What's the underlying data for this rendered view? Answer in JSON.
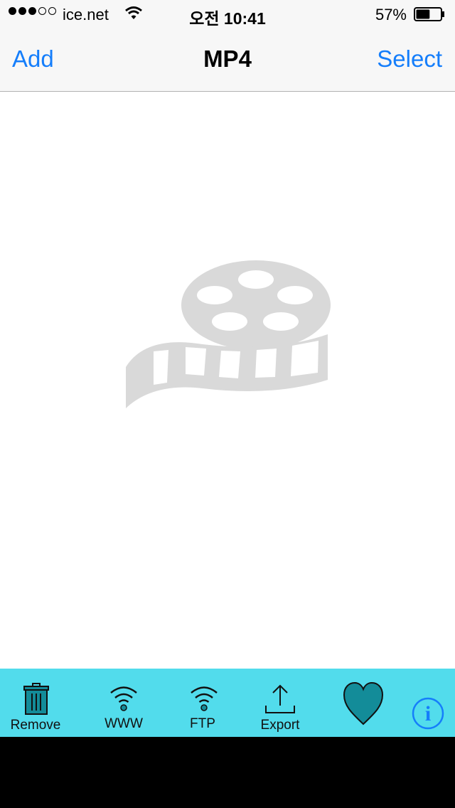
{
  "status_bar": {
    "signal_bars_filled": 3,
    "signal_bars_total": 5,
    "carrier": "ice.net",
    "time": "오전 10:41",
    "battery_percent": "57%",
    "battery_level": 0.57
  },
  "nav": {
    "left_label": "Add",
    "title": "MP4",
    "right_label": "Select"
  },
  "placeholder": {
    "icon": "film-reel-icon"
  },
  "toolbar": {
    "remove_label": "Remove",
    "www_label": "WWW",
    "ftp_label": "FTP",
    "export_label": "Export"
  },
  "colors": {
    "accent": "#157efb",
    "toolbar_bg": "#52dcec",
    "icon_teal": "#138c99",
    "placeholder_gray": "#d9d9d9"
  }
}
